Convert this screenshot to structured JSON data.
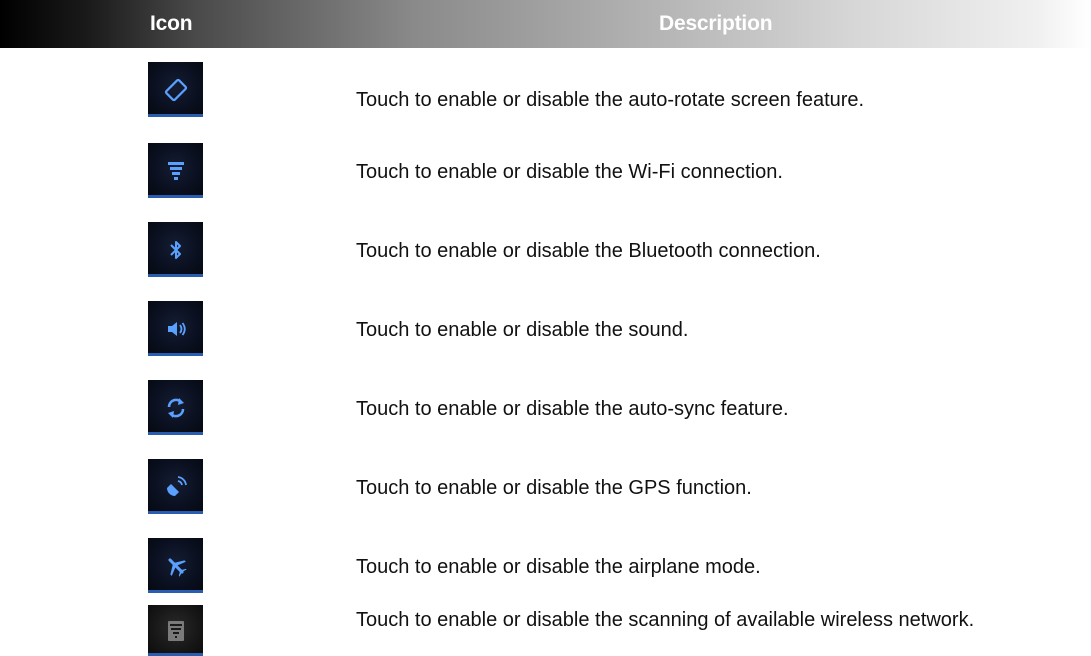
{
  "header": {
    "icon_label": "Icon",
    "description_label": "Description"
  },
  "rows": [
    {
      "icon": "auto-rotate-icon",
      "description": "Touch to enable or disable the auto-rotate screen feature."
    },
    {
      "icon": "wifi-icon",
      "description": "Touch to enable or disable the Wi-Fi connection."
    },
    {
      "icon": "bluetooth-icon",
      "description": "Touch to enable or disable the Bluetooth connection."
    },
    {
      "icon": "sound-icon",
      "description": "Touch to enable or disable the sound."
    },
    {
      "icon": "auto-sync-icon",
      "description": "Touch to enable or disable the auto-sync feature."
    },
    {
      "icon": "gps-icon",
      "description": "Touch to enable or disable the GPS function."
    },
    {
      "icon": "airplane-mode-icon",
      "description": "Touch to enable or disable the airplane mode."
    },
    {
      "icon": "wifi-scan-icon",
      "description": "Touch to enable or disable the scanning of available wireless network."
    }
  ],
  "colors": {
    "icon_active": "#5aa0ff",
    "icon_inactive": "#7a7a7a",
    "icon_underline": "#2a5db0"
  }
}
